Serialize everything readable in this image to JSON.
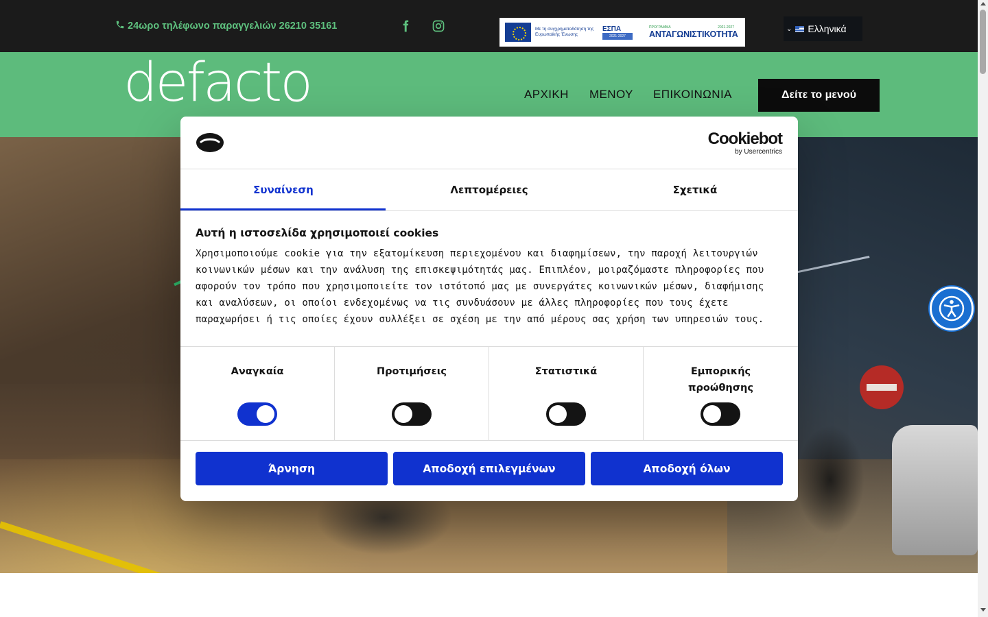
{
  "topbar": {
    "phone_text": "24ωρο τηλέφωνο παραγγελιών 26210 35161",
    "social": [
      "facebook-icon",
      "instagram-icon"
    ],
    "espa": {
      "cofunded_text": "Με τη συγχρηματοδότηση της Ευρωπαϊκής Ένωσης",
      "espa_label": "ΕΣΠΑ",
      "espa_years": "2021-2027",
      "program_label": "ΠΡΟΓΡΑΜΜΑ",
      "program_years": "2021-2027",
      "program_name": "ΑΝΤΑΓΩΝΙΣΤΙΚΟΤΗΤΑ"
    },
    "language": "Ελληνικά"
  },
  "header": {
    "logo_text": "defacto",
    "nav": [
      "ΑΡΧΙΚΗ",
      "ΜΕΝΟΥ",
      "ΕΠΙΚΟΙΝΩΝΙΑ"
    ],
    "cta": "Δείτε το μενού"
  },
  "cookie_dialog": {
    "brand": "Cookiebot",
    "brand_sub": "by Usercentrics",
    "tabs": [
      "Συναίνεση",
      "Λεπτομέρειες",
      "Σχετικά"
    ],
    "active_tab": "Συναίνεση",
    "heading": "Αυτή η ιστοσελίδα χρησιμοποιεί cookies",
    "body_lines": [
      "Χρησιμοποιούμε cookie για την εξατομίκευση περιεχομένου και διαφημίσεων, την παροχή λειτουργιών",
      "κοινωνικών μέσων και την ανάλυση της επισκεψιμότητάς μας. Επιπλέον, μοιραζόμαστε πληροφορίες που",
      "αφορούν τον τρόπο που χρησιμοποιείτε τον ιστότοπό μας με συνεργάτες κοινωνικών μέσων, διαφήμισης",
      "και αναλύσεων, οι οποίοι ενδεχομένως να τις συνδυάσουν με άλλες πληροφορίες που τους έχετε",
      "παραχωρήσει ή τις οποίες έχουν συλλέξει σε σχέση με την από μέρους σας χρήση των υπηρεσιών τους."
    ],
    "categories": [
      {
        "label_line1": "Αναγκαία",
        "label_line2": "",
        "enabled": true
      },
      {
        "label_line1": "Προτιμήσεις",
        "label_line2": "",
        "enabled": false
      },
      {
        "label_line1": "Στατιστικά",
        "label_line2": "",
        "enabled": false
      },
      {
        "label_line1": "Εμπορικής",
        "label_line2": "προώθησης",
        "enabled": false
      }
    ],
    "buttons": {
      "deny": "Άρνηση",
      "accept_selected": "Αποδοχή επιλεγμένων",
      "accept_all": "Αποδοχή όλων"
    }
  },
  "colors": {
    "topbar_bg": "#1b1b1b",
    "brand_green": "#5dbb7c",
    "phone_green": "#5ec07e",
    "cookiebot_blue": "#1032cf",
    "accessibility_blue": "#1a6fd1"
  }
}
